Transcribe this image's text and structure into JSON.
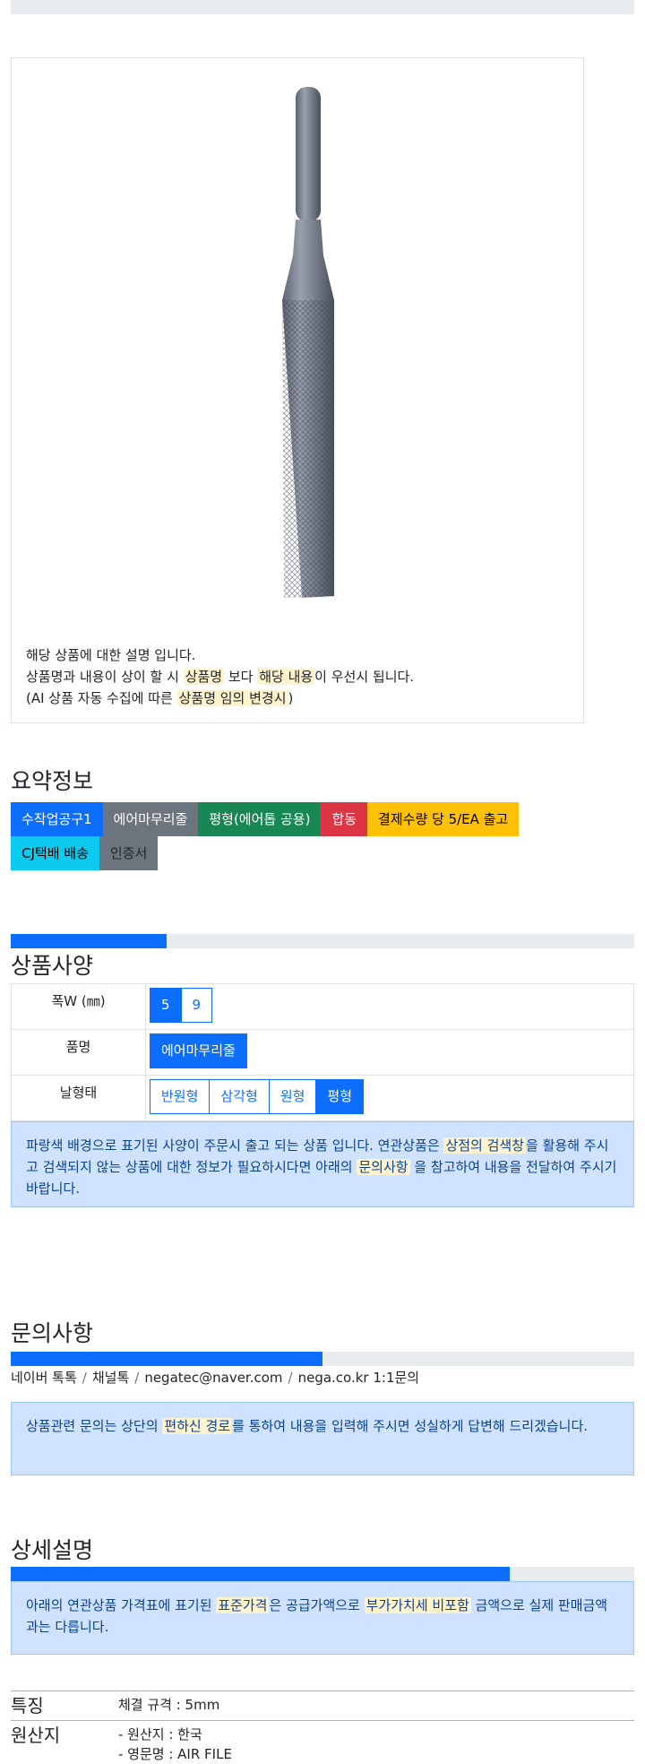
{
  "product": {
    "image_alt": "air file product",
    "description": {
      "line1": "해당 상품에 대한 설명 입니다.",
      "line2_pre": "상품명과 내용이 상이 할 시 ",
      "line2_hl1": "상품명",
      "line2_mid": " 보다 ",
      "line2_hl2": "해당 내용",
      "line2_post": "이 우선시 됩니다.",
      "line3_pre": "(AI 상품 자동 수집에 따른 ",
      "line3_hl": "상품명 임의 변경시",
      "line3_post": ")"
    }
  },
  "summary": {
    "title": "요약정보",
    "badges": [
      {
        "label": "수작업공구1",
        "color": "#0d6efd"
      },
      {
        "label": "에어마무리줄",
        "color": "#6c757d"
      },
      {
        "label": "평형(에어톱 공용)",
        "color": "#198754"
      },
      {
        "label": "합동",
        "color": "#dc3545"
      },
      {
        "label": "결제수량 당 5/EA 출고",
        "color": "#ffc107"
      },
      {
        "label": "CJ택배 배송",
        "color": "#0dcaf0"
      },
      {
        "label": "인증서",
        "color": "#6c757d"
      }
    ]
  },
  "spec": {
    "title": "상품사양",
    "progress": 0.25,
    "rows": [
      {
        "label": "폭W (㎜)",
        "options": [
          "5",
          "9"
        ],
        "active": 0
      },
      {
        "label": "품명",
        "options": [
          "에어마무리줄"
        ],
        "active": 0
      },
      {
        "label": "날형태",
        "options": [
          "반원형",
          "삼각형",
          "원형",
          "평형"
        ],
        "active": 3
      }
    ],
    "notice": {
      "pre": "파랑색 배경으로 표기된 사양이 주문시 출고 되는 상품 입니다. 연관상품은 ",
      "hl1": "상점의 검색창",
      "mid": "을 활용해 주시고 검색되지 않는 상품에 대한 정보가 필요하시다면 아래의 ",
      "hl2": "문의사항",
      "post": " 을 참고하여 내용을 전달하여 주시기 바랍니다."
    }
  },
  "inquiry": {
    "title": "문의사항",
    "progress": 0.5,
    "contacts": [
      "네이버 톡톡",
      "채널톡",
      "negatec@naver.com",
      "nega.co.kr 1:1문의"
    ],
    "notice": {
      "pre": "상품관련 문의는 상단의 ",
      "hl": "편하신 경로",
      "post": "를 통하여 내용을 입력해 주시면 성실하게 답변해 드리겠습니다."
    }
  },
  "detail": {
    "title": "상세설명",
    "progress": 0.8,
    "notice": {
      "pre": "아래의 연관상품 가격표에 표기된 ",
      "hl1": "표준가격",
      "mid": "은 공급가액으로 ",
      "hl2": "부가가치세 비포함",
      "post": " 금액으로 실제 판매금액과는 다릅니다."
    },
    "info": [
      {
        "key": "특징",
        "values": [
          "체결 규격 : 5mm"
        ]
      },
      {
        "key": "원산지",
        "values": [
          "- 원산지 : 한국",
          "- 영문명 : AIR FILE"
        ]
      }
    ]
  }
}
